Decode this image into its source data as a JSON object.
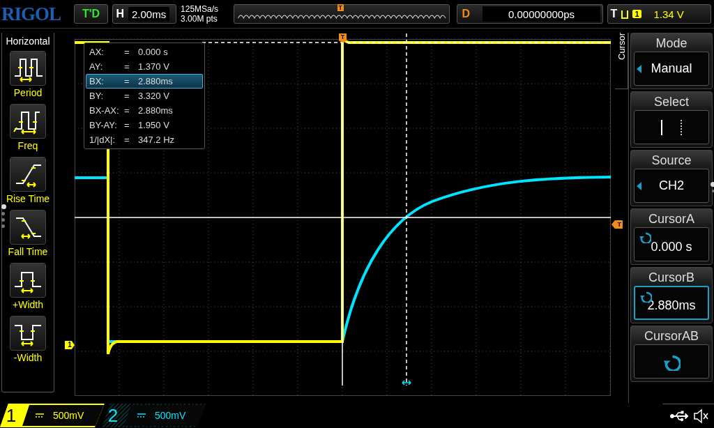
{
  "top_bar": {
    "logo": "RIGOL",
    "run_status": "T'D",
    "timebase": {
      "label": "H",
      "value": "2.00ms"
    },
    "sample_rate": "125MSa/s",
    "memory_depth": "3.00M pts",
    "overview_marker": "T",
    "delay": {
      "label": "D",
      "value": "0.00000000ps"
    },
    "trigger": {
      "label": "T",
      "source": "1",
      "level": "1.34 V"
    }
  },
  "measure_menu": {
    "title": "Horizontal",
    "items": [
      {
        "label": "Period",
        "kind": "period"
      },
      {
        "label": "Freq",
        "kind": "freq"
      },
      {
        "label": "Rise Time",
        "kind": "rise"
      },
      {
        "label": "Fall Time",
        "kind": "fall"
      },
      {
        "label": "+Width",
        "kind": "pwidth"
      },
      {
        "label": "-Width",
        "kind": "nwidth"
      }
    ],
    "pages": [
      {
        "selected": true
      },
      {
        "selected": false
      },
      {
        "selected": false
      },
      {
        "selected": false
      }
    ]
  },
  "cursor_readout": [
    {
      "label": "AX:",
      "eq": "=",
      "value": "0.000 s",
      "selected": false
    },
    {
      "label": "AY:",
      "eq": "=",
      "value": "1.370 V",
      "selected": false
    },
    {
      "label": "BX:",
      "eq": "=",
      "value": "2.880ms",
      "selected": true
    },
    {
      "label": "BY:",
      "eq": "=",
      "value": "3.320 V",
      "selected": false
    },
    {
      "label": "BX-AX:",
      "eq": "=",
      "value": "2.880ms",
      "selected": false
    },
    {
      "label": "BY-AY:",
      "eq": "=",
      "value": "1.950 V",
      "selected": false
    },
    {
      "label": "1/|dX|:",
      "eq": "=",
      "value": "347.2 Hz",
      "selected": false
    }
  ],
  "markers": {
    "channel_1": "1",
    "trigger_position": "T",
    "trigger_level": "T"
  },
  "cursor_menu": {
    "title": "Cursor",
    "items": [
      {
        "label": "Mode",
        "kind": "choice",
        "value": "Manual",
        "selected": false
      },
      {
        "label": "Select",
        "kind": "select",
        "selected": false
      },
      {
        "label": "Source",
        "kind": "choice",
        "value": "CH2",
        "selected": false
      },
      {
        "label": "CursorA",
        "kind": "knob",
        "value": "0.000 s",
        "selected": false
      },
      {
        "label": "CursorB",
        "kind": "knob",
        "value": "2.880ms",
        "selected": true
      },
      {
        "label": "CursorAB",
        "kind": "knob",
        "selected": false
      }
    ],
    "pages": [
      {
        "selected": true
      },
      {
        "selected": false
      }
    ]
  },
  "channels": [
    {
      "number": "1",
      "scale": "500mV",
      "color": "#ffff00",
      "active": true
    },
    {
      "number": "2",
      "scale": "500mV",
      "color": "#00e5ff",
      "active": false
    }
  ]
}
